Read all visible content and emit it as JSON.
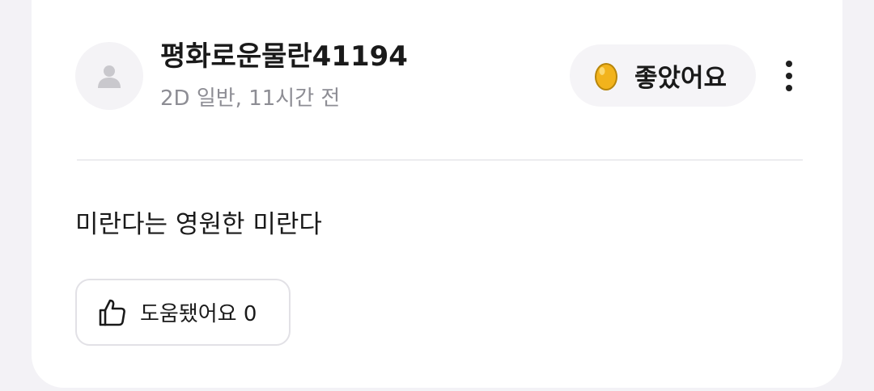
{
  "post": {
    "username": "평화로운물란41194",
    "meta": "2D 일반, 11시간 전",
    "content": "미란다는 영원한 미란다",
    "reaction": {
      "icon": "egg-icon",
      "label": "좋았어요"
    },
    "helpful": {
      "icon": "thumbs-up-icon",
      "label": "도움됐어요 0"
    }
  },
  "colors": {
    "background": "#f3f2f6",
    "card": "#ffffff",
    "chip": "#f5f4f7",
    "meta_text": "#8d8d94",
    "egg": "#f2b31c"
  }
}
